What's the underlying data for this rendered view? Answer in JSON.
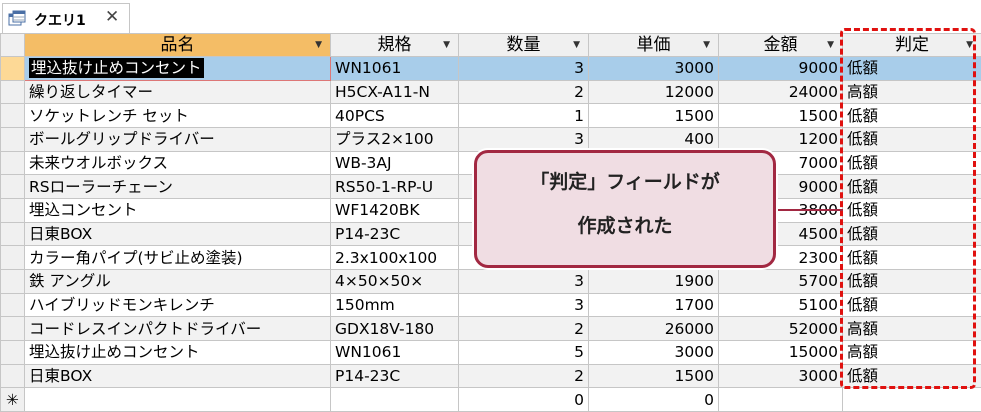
{
  "tab": {
    "title": "クエリ1",
    "close_glyph": "✕"
  },
  "columns": [
    {
      "label": "品名",
      "highlighted": true
    },
    {
      "label": "規格",
      "highlighted": false
    },
    {
      "label": "数量",
      "highlighted": false
    },
    {
      "label": "単価",
      "highlighted": false
    },
    {
      "label": "金額",
      "highlighted": false
    },
    {
      "label": "判定",
      "highlighted": false
    }
  ],
  "sort_arrow_glyph": "▼",
  "rows": [
    {
      "name": "埋込抜け止めコンセント",
      "spec": "WN1061",
      "qty": "3",
      "price": "3000",
      "amount": "9000",
      "judge": "低額"
    },
    {
      "name": "繰り返しタイマー",
      "spec": "H5CX-A11-N",
      "qty": "2",
      "price": "12000",
      "amount": "24000",
      "judge": "高額"
    },
    {
      "name": "ソケットレンチ セット",
      "spec": "40PCS",
      "qty": "1",
      "price": "1500",
      "amount": "1500",
      "judge": "低額"
    },
    {
      "name": "ボールグリップドライバー",
      "spec": "プラス2×100",
      "qty": "3",
      "price": "400",
      "amount": "1200",
      "judge": "低額"
    },
    {
      "name": "未来ウオルボックス",
      "spec": "WB-3AJ",
      "qty": "",
      "price": "",
      "amount": "7000",
      "judge": "低額"
    },
    {
      "name": "RSローラーチェーン",
      "spec": "RS50-1-RP-U",
      "qty": "",
      "price": "",
      "amount": "9000",
      "judge": "低額"
    },
    {
      "name": "埋込コンセント",
      "spec": "WF1420BK",
      "qty": "",
      "price": "",
      "amount": "3800",
      "judge": "低額"
    },
    {
      "name": "日東BOX",
      "spec": "P14-23C",
      "qty": "",
      "price": "",
      "amount": "4500",
      "judge": "低額"
    },
    {
      "name": "カラー角パイプ(サビ止め塗装)",
      "spec": "2.3x100x100",
      "qty": "",
      "price": "",
      "amount": "2300",
      "judge": "低額"
    },
    {
      "name": "鉄 アングル",
      "spec": "4×50×50×",
      "qty": "3",
      "price": "1900",
      "amount": "5700",
      "judge": "低額"
    },
    {
      "name": "ハイブリッドモンキレンチ",
      "spec": "150mm",
      "qty": "3",
      "price": "1700",
      "amount": "5100",
      "judge": "低額"
    },
    {
      "name": "コードレスインパクトドライバー",
      "spec": "GDX18V-180",
      "qty": "2",
      "price": "26000",
      "amount": "52000",
      "judge": "高額"
    },
    {
      "name": "埋込抜け止めコンセント",
      "spec": "WN1061",
      "qty": "5",
      "price": "3000",
      "amount": "15000",
      "judge": "高額"
    },
    {
      "name": "日東BOX",
      "spec": "P14-23C",
      "qty": "2",
      "price": "1500",
      "amount": "3000",
      "judge": "低額"
    }
  ],
  "new_row": {
    "marker": "✳",
    "qty": "0",
    "price": "0"
  },
  "callout": {
    "line1": "「判定」フィールドが",
    "line2": "作成された"
  },
  "colors": {
    "header_highlight": "#f4bd66",
    "current_row": "#a8cdea",
    "dashed_border": "#e0110f",
    "callout_border": "#a22842",
    "callout_fill": "#f0dde3"
  }
}
